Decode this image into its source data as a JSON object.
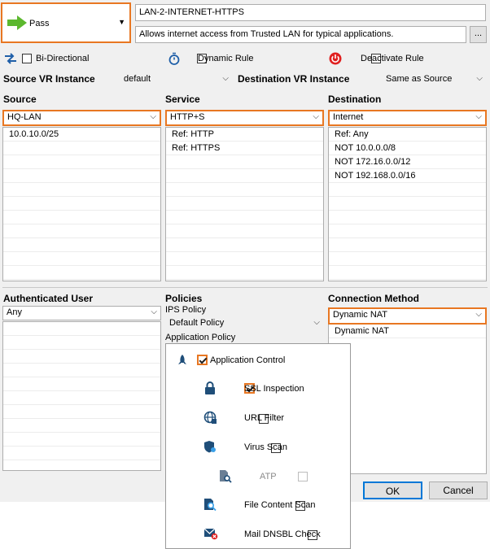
{
  "action": {
    "label": "Pass",
    "arrow_icon": "right-arrow-icon"
  },
  "rule": {
    "name": "LAN-2-INTERNET-HTTPS",
    "description": "Allows internet access from Trusted LAN for typical applications.",
    "more_button": "..."
  },
  "options": {
    "bidirectional": "Bi-Directional",
    "dynamic_rule": "Dynamic Rule",
    "deactivate_rule": "Deactivate Rule"
  },
  "vr": {
    "source_label": "Source VR Instance",
    "source_value": "default",
    "dest_label": "Destination VR Instance",
    "dest_value": "Same as Source"
  },
  "source": {
    "label": "Source",
    "selected": "HQ-LAN",
    "items": [
      "10.0.10.0/25"
    ]
  },
  "service": {
    "label": "Service",
    "selected": "HTTP+S",
    "items": [
      "Ref: HTTP",
      "Ref: HTTPS"
    ]
  },
  "destination": {
    "label": "Destination",
    "selected": "Internet",
    "items": [
      "Ref: Any",
      "NOT 10.0.0.0/8",
      "NOT 172.16.0.0/12",
      "NOT 192.168.0.0/16"
    ]
  },
  "auth_user": {
    "label": "Authenticated User",
    "selected": "Any"
  },
  "policies": {
    "label": "Policies",
    "ips_label": "IPS Policy",
    "ips_value": "Default Policy",
    "app_label": "Application Policy"
  },
  "connection": {
    "label": "Connection Method",
    "selected": "Dynamic NAT",
    "items": [
      "Dynamic NAT"
    ]
  },
  "app_policy_menu": {
    "application_control": "Application Control",
    "ssl_inspection": "SSL Inspection",
    "url_filter": "URL Filter",
    "virus_scan": "Virus Scan",
    "atp": "ATP",
    "file_content_scan": "File Content Scan",
    "mail_dnsbl_check": "Mail DNSBL Check"
  },
  "buttons": {
    "ok": "OK",
    "cancel": "Cancel"
  },
  "colors": {
    "highlight": "#e87722",
    "pass_green": "#5cb82e",
    "deactivate_red": "#e02020"
  }
}
